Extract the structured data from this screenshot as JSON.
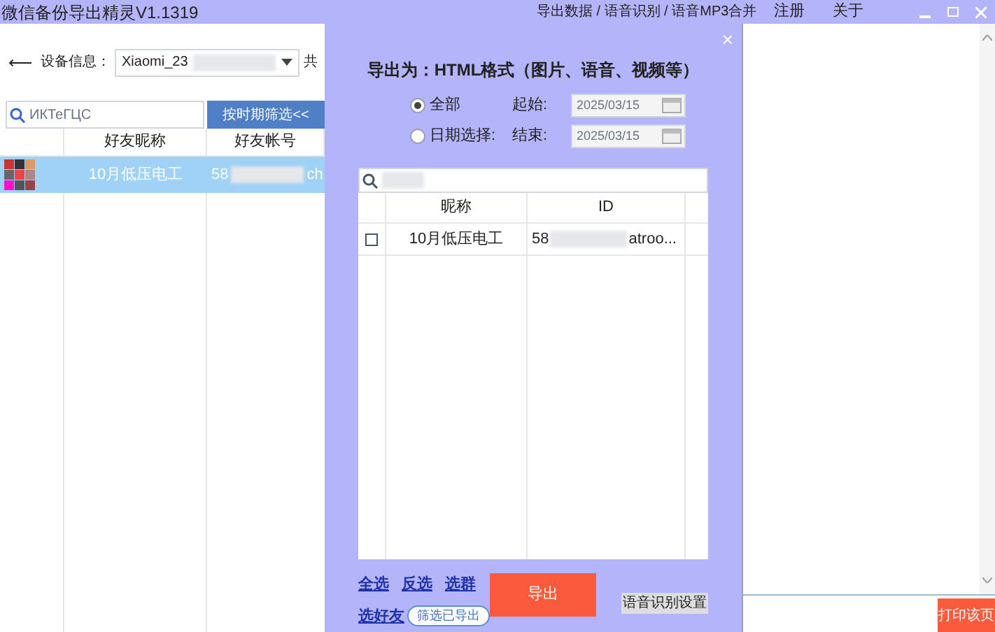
{
  "window": {
    "title": "微信备份导出精灵V1.1319",
    "menu": [
      "导出数据 / 语音识别 / 语音MP3合并",
      "注册",
      "关于"
    ]
  },
  "device": {
    "back": "⟵",
    "label": "设备信息：",
    "value": "Xiaomi_23",
    "count_label": "共"
  },
  "friends": {
    "search_placeholder": "ИКТеГЦС",
    "filter_button": "按时期筛选<<",
    "columns": [
      "好友昵称",
      "好友帐号"
    ],
    "rows": [
      {
        "nickname": "10月低压电工",
        "account_start": "58",
        "account_end": "ch",
        "selected": true
      }
    ]
  },
  "export_dialog": {
    "close": "×",
    "title": "导出为：HTML格式（图片、语音、视频等）",
    "ranges": [
      {
        "label": "全部",
        "selected": true
      },
      {
        "label": "日期选择:",
        "selected": false
      }
    ],
    "dates": [
      {
        "label": "起始:",
        "value": "2025/03/15",
        "disabled": true
      },
      {
        "label": "结束:",
        "value": "2025/03/15",
        "disabled": true
      }
    ],
    "columns": [
      "昵称",
      "ID"
    ],
    "rows": [
      {
        "checked": false,
        "nickname": "10月低压电工",
        "id_start": "58",
        "id_end": "atroo..."
      }
    ],
    "links": [
      [
        "全选",
        "反选",
        "选群"
      ],
      [
        "选好友"
      ]
    ],
    "filter_pill": "筛选已导出",
    "export_button": "导出",
    "voice_settings": "语音识别设置"
  },
  "side": {
    "print_button": "打印该页"
  }
}
